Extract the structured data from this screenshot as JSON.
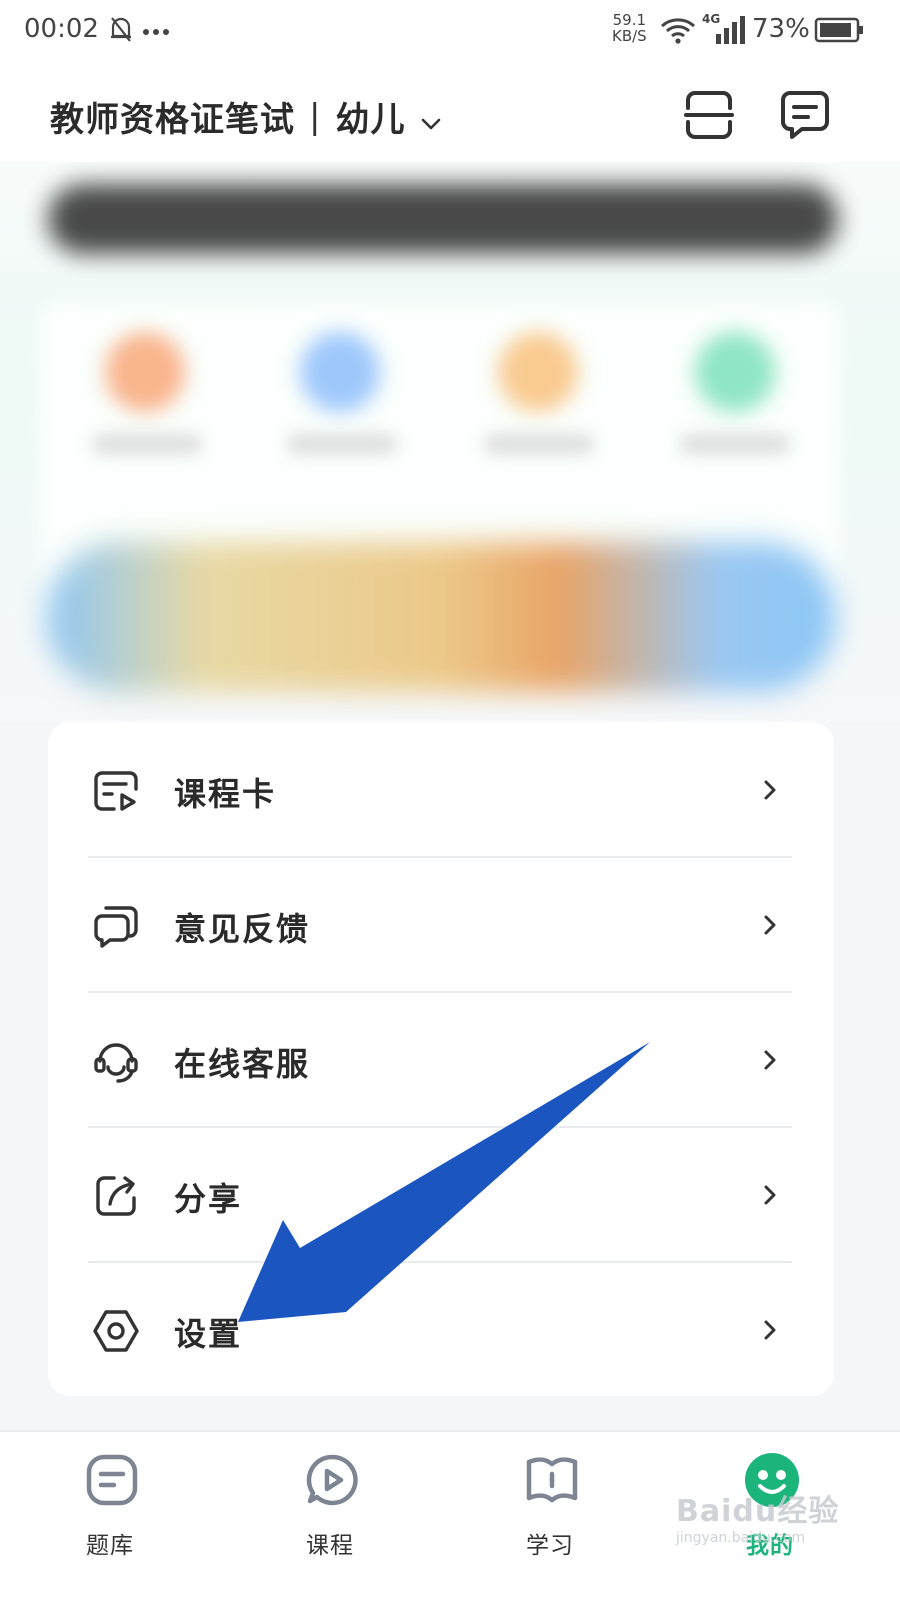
{
  "status_bar": {
    "time": "00:02",
    "net_speed_value": "59.1",
    "net_speed_unit": "KB/S",
    "network_type": "4G",
    "battery": "73%"
  },
  "header": {
    "title": "教师资格证笔试",
    "separator": "|",
    "subtitle": "幼儿"
  },
  "menu": {
    "items": [
      {
        "label": "课程卡",
        "icon": "course-card-icon"
      },
      {
        "label": "意见反馈",
        "icon": "feedback-icon"
      },
      {
        "label": "在线客服",
        "icon": "headset-icon"
      },
      {
        "label": "分享",
        "icon": "share-icon"
      },
      {
        "label": "设置",
        "icon": "settings-hexagon-icon"
      }
    ]
  },
  "bottom_nav": {
    "items": [
      {
        "label": "题库",
        "icon": "question-bank-icon",
        "active": false
      },
      {
        "label": "课程",
        "icon": "play-course-icon",
        "active": false
      },
      {
        "label": "学习",
        "icon": "book-icon",
        "active": false
      },
      {
        "label": "我的",
        "icon": "profile-icon",
        "active": true
      }
    ]
  },
  "watermark": {
    "main": "Baidu经验",
    "sub": "jingyan.baidu.com"
  },
  "colors": {
    "accent_green": "#1bb57c",
    "annotation_arrow": "#1a55c0",
    "icon_stroke": "#333333"
  }
}
